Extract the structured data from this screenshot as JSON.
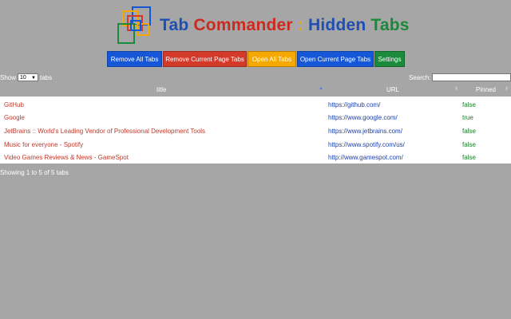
{
  "header": {
    "title_parts": [
      {
        "text": "Tab ",
        "color": "#1f4fb5"
      },
      {
        "text": "Commander",
        "color": "#cc2a1e"
      },
      {
        "text": " : ",
        "color": "#f2a900"
      },
      {
        "text": "Hidden ",
        "color": "#1f4fb5"
      },
      {
        "text": "Tabs",
        "color": "#1a8a3a"
      }
    ]
  },
  "toolbar": {
    "buttons": [
      {
        "label": "Remove All Tabs",
        "color": "#1557d6"
      },
      {
        "label": "Remove Current Page Tabs",
        "color": "#d33a2a"
      },
      {
        "label": "Open All Tabs",
        "color": "#f5a800"
      },
      {
        "label": "Open Current Page Tabs",
        "color": "#1557d6"
      },
      {
        "label": "Settings",
        "color": "#1b8a3a"
      }
    ]
  },
  "controls": {
    "show_label": "Show",
    "page_size": "10",
    "tabs_label": "tabs",
    "search_label": "Search:",
    "search_value": ""
  },
  "table": {
    "columns": [
      "title",
      "URL",
      "Pinned"
    ],
    "rows": [
      {
        "title": "GitHub",
        "url": "https://github.com/",
        "pinned": "false"
      },
      {
        "title": "Google",
        "url": "https://www.google.com/",
        "pinned": "true"
      },
      {
        "title": "JetBrains :: World's Leading Vendor of Professional Development Tools",
        "url": "https://www.jetbrains.com/",
        "pinned": "false"
      },
      {
        "title": "Music for everyone - Spotify",
        "url": "https://www.spotify.com/us/",
        "pinned": "false"
      },
      {
        "title": "Video Games Reviews & News - GameSpot",
        "url": "http://www.gamespot.com/",
        "pinned": "false"
      }
    ]
  },
  "footer": {
    "info": "Showing 1 to 5 of 5 tabs"
  }
}
